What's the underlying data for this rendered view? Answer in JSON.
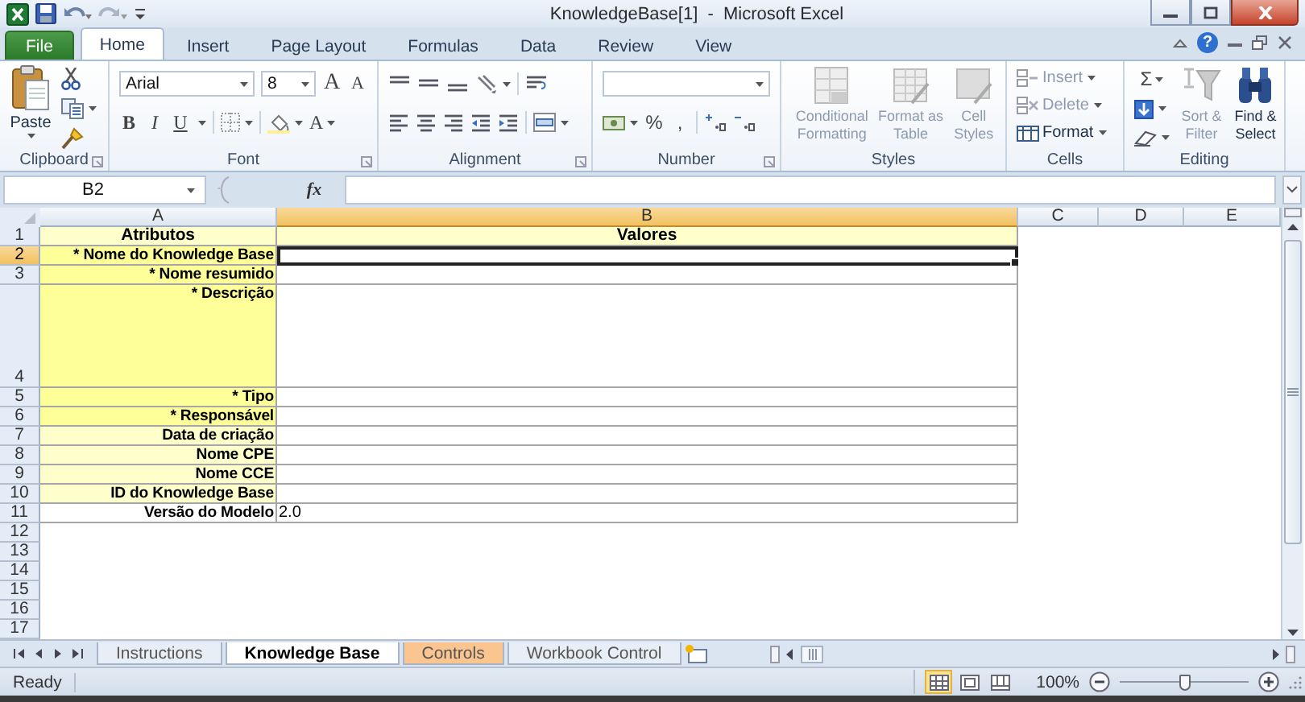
{
  "window": {
    "title": "KnowledgeBase[1]  -  Microsoft Excel",
    "help": "?"
  },
  "ribbon_tabs": [
    {
      "label": "File",
      "kind": "file",
      "selected": false
    },
    {
      "label": "Home",
      "kind": "tab",
      "selected": true
    },
    {
      "label": "Insert",
      "kind": "tab",
      "selected": false
    },
    {
      "label": "Page Layout",
      "kind": "tab",
      "selected": false
    },
    {
      "label": "Formulas",
      "kind": "tab",
      "selected": false
    },
    {
      "label": "Data",
      "kind": "tab",
      "selected": false
    },
    {
      "label": "Review",
      "kind": "tab",
      "selected": false
    },
    {
      "label": "View",
      "kind": "tab",
      "selected": false
    }
  ],
  "ribbon": {
    "clipboard": {
      "label": "Clipboard",
      "paste": "Paste"
    },
    "font": {
      "label": "Font",
      "font_name": "Arial",
      "font_size": "8",
      "grow": "A",
      "shrink": "A",
      "bold": "B",
      "italic": "I",
      "underline": "U",
      "font_color": "A"
    },
    "alignment": {
      "label": "Alignment"
    },
    "number": {
      "label": "Number",
      "percent": "%",
      "comma": ","
    },
    "styles": {
      "label": "Styles",
      "buttons": [
        {
          "label": "Conditional Formatting",
          "disabled": true
        },
        {
          "label": "Format as Table",
          "disabled": true
        },
        {
          "label": "Cell Styles",
          "disabled": true
        }
      ]
    },
    "cells": {
      "label": "Cells",
      "buttons": [
        {
          "label": "Insert",
          "disabled": true
        },
        {
          "label": "Delete",
          "disabled": true
        },
        {
          "label": "Format",
          "disabled": false
        }
      ]
    },
    "editing": {
      "label": "Editing",
      "autosum": "Σ",
      "buttons": [
        {
          "label": "Sort & Filter",
          "disabled": true
        },
        {
          "label": "Find & Select",
          "disabled": false
        }
      ]
    }
  },
  "formula_bar": {
    "name_box": "B2",
    "function_label": "fx"
  },
  "sheet": {
    "columns": [
      {
        "label": "A",
        "selected": false
      },
      {
        "label": "B",
        "selected": true
      },
      {
        "label": "C",
        "selected": false
      },
      {
        "label": "D",
        "selected": false
      },
      {
        "label": "E",
        "selected": false
      }
    ],
    "rows": [
      {
        "number": "1",
        "kind": "header",
        "selected": false,
        "cells": [
          {
            "text": "Atributos",
            "selected": false
          },
          {
            "text": "Valores",
            "selected": false
          }
        ]
      },
      {
        "number": "2",
        "kind": "required",
        "selected": true,
        "cells": [
          {
            "text": "* Nome do Knowledge Base",
            "selected": false
          },
          {
            "selected": true
          }
        ]
      },
      {
        "number": "3",
        "kind": "required",
        "selected": false,
        "cells": [
          {
            "text": "* Nome resumido",
            "selected": false
          },
          {
            "selected": false
          }
        ]
      },
      {
        "number": "4",
        "kind": "required",
        "selected": false,
        "cells": [
          {
            "text": "* Descrição",
            "selected": false
          },
          {
            "selected": false
          }
        ]
      },
      {
        "number": "5",
        "kind": "required",
        "selected": false,
        "cells": [
          {
            "text": "* Tipo",
            "selected": false
          },
          {
            "selected": false
          }
        ]
      },
      {
        "number": "6",
        "kind": "required",
        "selected": false,
        "cells": [
          {
            "text": "* Responsável",
            "selected": false
          },
          {
            "selected": false
          }
        ]
      },
      {
        "number": "7",
        "kind": "optional",
        "selected": false,
        "cells": [
          {
            "text": "Data de criação",
            "selected": false
          },
          {
            "selected": false
          }
        ]
      },
      {
        "number": "8",
        "kind": "optional",
        "selected": false,
        "cells": [
          {
            "text": "Nome CPE",
            "selected": false
          },
          {
            "selected": false
          }
        ]
      },
      {
        "number": "9",
        "kind": "optional",
        "selected": false,
        "cells": [
          {
            "text": "Nome CCE",
            "selected": false
          },
          {
            "selected": false
          }
        ]
      },
      {
        "number": "10",
        "kind": "optional",
        "selected": false,
        "cells": [
          {
            "text": "ID do Knowledge Base",
            "selected": false
          },
          {
            "selected": false
          }
        ]
      },
      {
        "number": "11",
        "kind": "plain",
        "selected": false,
        "cells": [
          {
            "text": "Versão do Modelo",
            "selected": false
          },
          {
            "text": "2.0",
            "selected": false
          }
        ]
      },
      {
        "number": "12",
        "kind": "empty",
        "selected": false
      },
      {
        "number": "13",
        "kind": "empty",
        "selected": false
      },
      {
        "number": "14",
        "kind": "empty",
        "selected": false
      },
      {
        "number": "15",
        "kind": "empty",
        "selected": false
      },
      {
        "number": "16",
        "kind": "empty",
        "selected": false
      },
      {
        "number": "17",
        "kind": "empty",
        "selected": false
      }
    ]
  },
  "sheet_tabs": [
    {
      "label": "Instructions",
      "selected": false
    },
    {
      "label": "Knowledge Base",
      "selected": true
    },
    {
      "label": "Controls",
      "selected": false,
      "color": "#fac58f"
    },
    {
      "label": "Workbook Control",
      "selected": false
    }
  ],
  "status_bar": {
    "text": "Ready",
    "views": [
      {
        "kind": "normal",
        "selected": true
      },
      {
        "kind": "layout",
        "selected": false
      },
      {
        "kind": "pagebreak",
        "selected": false
      }
    ],
    "zoom": {
      "label": "100%",
      "level": 0.5
    }
  }
}
